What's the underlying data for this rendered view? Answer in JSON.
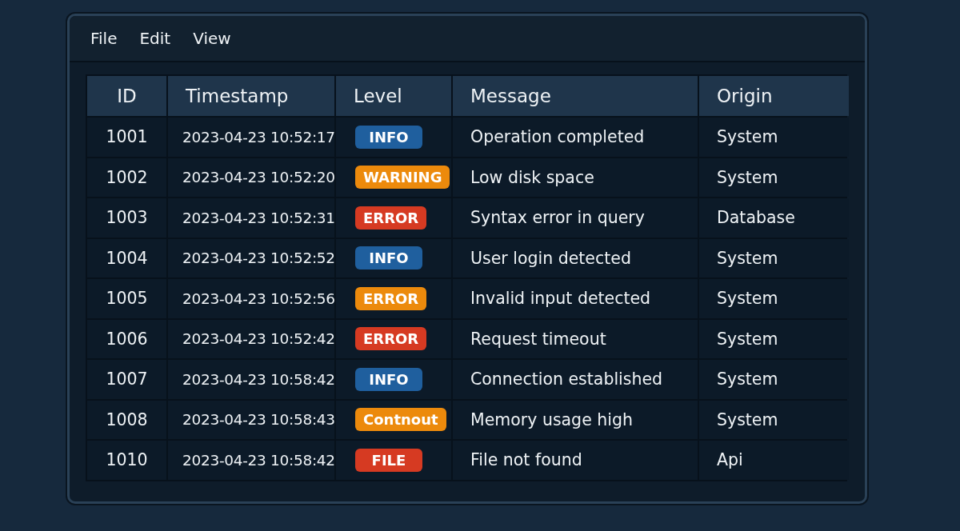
{
  "menu": [
    "File",
    "Edit",
    "View"
  ],
  "table": {
    "columns": [
      "ID",
      "Timestamp",
      "Level",
      "Message",
      "Origin"
    ],
    "rows": [
      {
        "id": "1001",
        "timestamp": "2023-04-23 10:52:17",
        "level": {
          "label": "INFO",
          "color": "#1f5f9e"
        },
        "message": "Operation completed",
        "origin": "System"
      },
      {
        "id": "1002",
        "timestamp": "2023-04-23 10:52:20",
        "level": {
          "label": "WARNING",
          "color": "#ec8a0c"
        },
        "message": "Low disk space",
        "origin": "System"
      },
      {
        "id": "1003",
        "timestamp": "2023-04-23 10:52:31",
        "level": {
          "label": "ERROR",
          "color": "#d63a22"
        },
        "message": "Syntax error in query",
        "origin": "Database"
      },
      {
        "id": "1004",
        "timestamp": "2023-04-23 10:52:52",
        "level": {
          "label": "INFO",
          "color": "#1f5f9e"
        },
        "message": "User login detected",
        "origin": "System"
      },
      {
        "id": "1005",
        "timestamp": "2023-04-23 10:52:56",
        "level": {
          "label": "ERROR",
          "color": "#ec8a0c"
        },
        "message": "Invalid input detected",
        "origin": "System"
      },
      {
        "id": "1006",
        "timestamp": "2023-04-23 10:52:42",
        "level": {
          "label": "ERROR",
          "color": "#d63a22"
        },
        "message": "Request timeout",
        "origin": "System"
      },
      {
        "id": "1007",
        "timestamp": "2023-04-23 10:58:42",
        "level": {
          "label": "INFO",
          "color": "#1f5f9e"
        },
        "message": "Connection established",
        "origin": "System"
      },
      {
        "id": "1008",
        "timestamp": "2023-04-23 10:58:43",
        "level": {
          "label": "Contnout",
          "color": "#ec8a0c"
        },
        "message": "Memory usage high",
        "origin": "System"
      },
      {
        "id": "1010",
        "timestamp": "2023-04-23 10:58:42",
        "level": {
          "label": "FILE",
          "color": "#d63a22"
        },
        "message": "File not found",
        "origin": "Api"
      }
    ]
  }
}
